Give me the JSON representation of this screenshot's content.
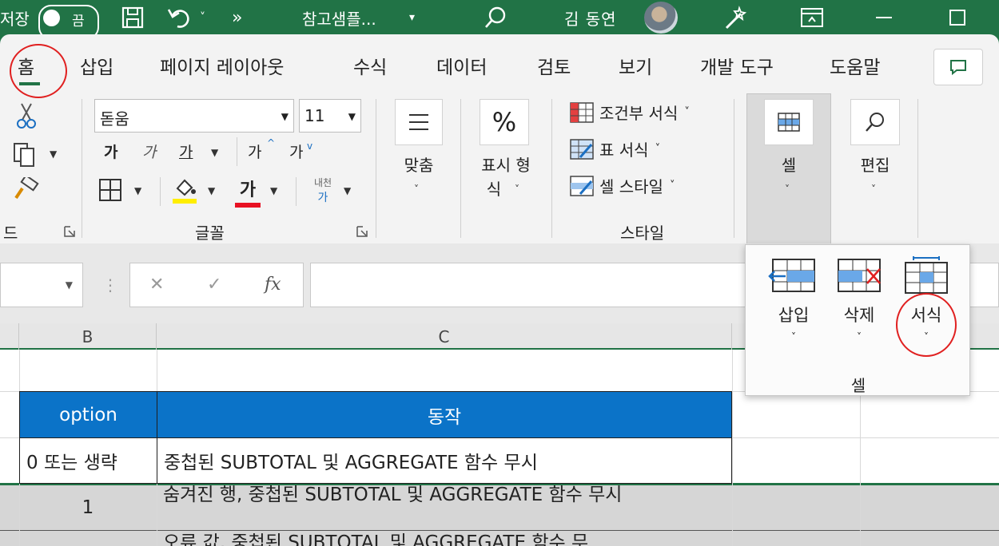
{
  "titlebar": {
    "autosave_label": "저장",
    "autosave_state": "끔",
    "doc_title": "참고샘플...",
    "user_name": "김 동연",
    "more_glyph": "»",
    "undo_dropdown": "˅",
    "title_dropdown": "▾"
  },
  "tabs": [
    {
      "label": "홈",
      "active": true
    },
    {
      "label": "삽입"
    },
    {
      "label": "페이지 레이아웃"
    },
    {
      "label": "수식"
    },
    {
      "label": "데이터"
    },
    {
      "label": "검토"
    },
    {
      "label": "보기"
    },
    {
      "label": "개발 도구"
    },
    {
      "label": "도움말"
    }
  ],
  "clipboard": {
    "group_label": "드"
  },
  "font": {
    "name": "돋움",
    "size": "11",
    "bold": "가",
    "italic": "가",
    "underline": "가",
    "grow": "가",
    "shrink": "가",
    "font_color_glyph": "가",
    "phonetic_top": "내천",
    "phonetic_bottom": "가",
    "group_label": "글꼴",
    "fill_color": "#ffee00",
    "text_color": "#e81123"
  },
  "alignment": {
    "label": "맞춤"
  },
  "number": {
    "label_line1": "표시 형",
    "label_line2": "식"
  },
  "styles": {
    "conditional": "조건부 서식",
    "table_format": "표 서식",
    "cell_style": "셀 스타일",
    "group_label": "스타일"
  },
  "cells_group": {
    "label": "셀"
  },
  "editing": {
    "label": "편집"
  },
  "formula_bar": {
    "fx": "fx",
    "cancel": "✕",
    "enter": "✓",
    "value": ""
  },
  "cells_panel": {
    "insert": "삽입",
    "delete": "삭제",
    "format": "서식",
    "group_label": "셀"
  },
  "columns": [
    "B",
    "C"
  ],
  "table": {
    "headers": [
      "option",
      "동작"
    ],
    "rows": [
      [
        "0 또는 생략",
        "중첩된 SUBTOTAL 및 AGGREGATE 함수 무시"
      ],
      [
        "1",
        "숨겨진 행, 중첩된 SUBTOTAL 및 AGGREGATE 함수 무시"
      ],
      [
        "",
        "오류 값, 중첩된 SUBTOTAL 및 AGGREGATE 함수 무"
      ]
    ],
    "header_color": "#0b73c8"
  },
  "colors": {
    "accent": "#217346",
    "highlight_circle": "#e02020"
  }
}
